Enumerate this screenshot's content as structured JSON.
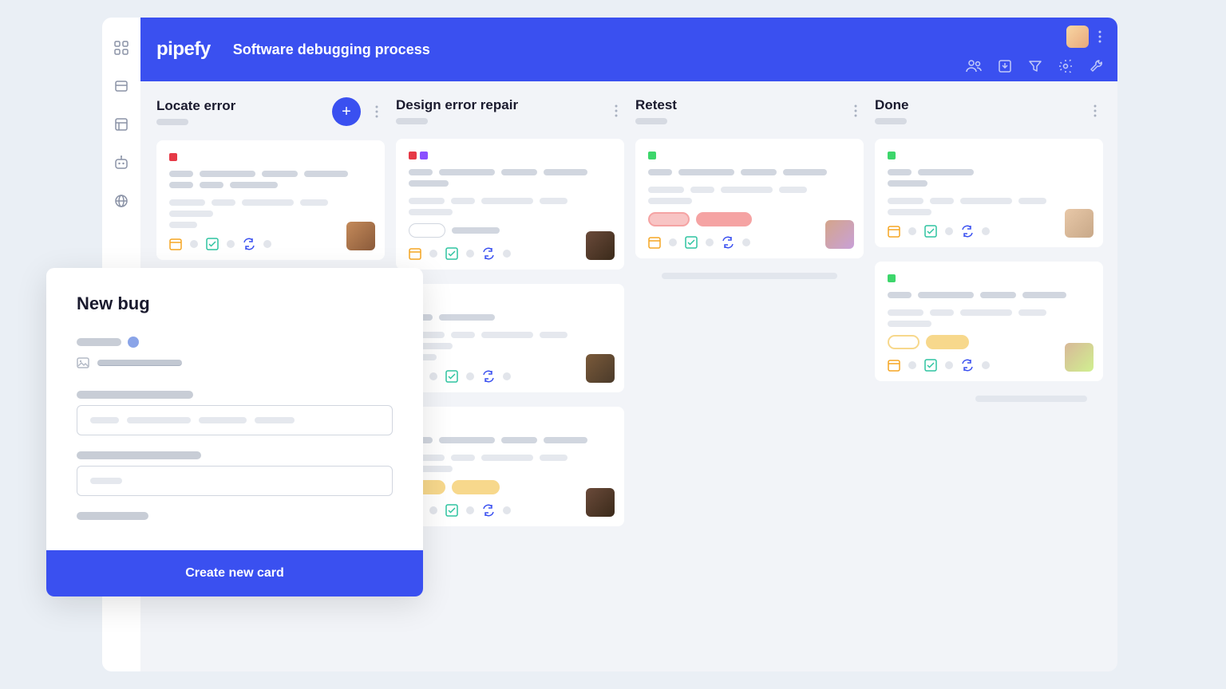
{
  "header": {
    "logo": "pipefy",
    "title": "Software debugging process"
  },
  "columns": [
    {
      "title": "Locate error",
      "hasAdd": true
    },
    {
      "title": "Design error repair",
      "hasAdd": false
    },
    {
      "title": "Retest",
      "hasAdd": false
    },
    {
      "title": "Done",
      "hasAdd": false
    }
  ],
  "modal": {
    "title": "New bug",
    "button": "Create new card"
  },
  "colors": {
    "red": "#e63946",
    "purple": "#8a4fff",
    "green": "#3dd66b",
    "orange": "#f5a623",
    "pink": "#f5a3a3",
    "yellow": "#f7d88c",
    "teal": "#2ec4a0",
    "blue": "#3a50f0"
  },
  "avatars": {
    "a1": "linear-gradient(135deg,#c48a5a,#8a5a3a)",
    "a2": "linear-gradient(135deg,#6a4a3a,#3a2a1a)",
    "a3": "linear-gradient(135deg,#d4a58a,#a57a5a)",
    "a4": "linear-gradient(135deg,#e8c8a8,#c8a888)",
    "a5": "linear-gradient(135deg,#d8b898,#b89878)"
  }
}
